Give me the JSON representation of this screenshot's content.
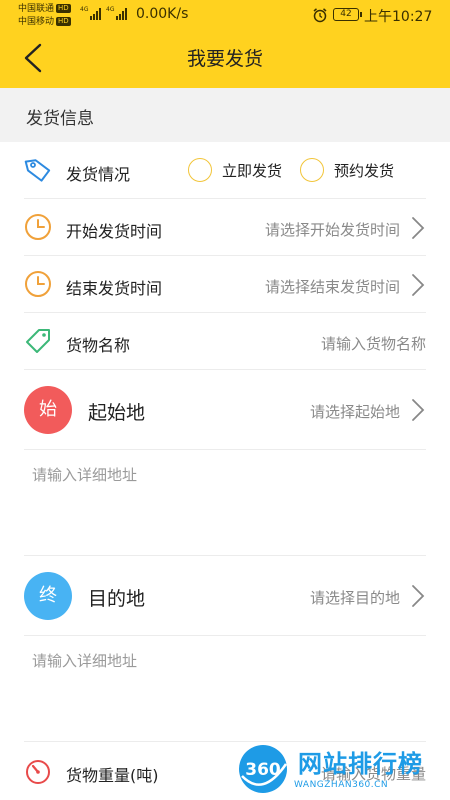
{
  "status_bar": {
    "carrier1": "中国联通",
    "carrier2": "中国移动",
    "hd_badge": "HD",
    "network": "4G",
    "speed": "0.00K/s",
    "battery": "42",
    "time": "上午10:27"
  },
  "header": {
    "title": "我要发货",
    "back_icon": "chevron-left-icon",
    "background": "#ffd21f"
  },
  "section": {
    "title": "发货信息"
  },
  "shipping_status": {
    "label": "发货情况",
    "icon": "tag-icon",
    "options": [
      "立即发货",
      "预约发货"
    ]
  },
  "start_time": {
    "label": "开始发货时间",
    "placeholder": "请选择开始发货时间",
    "icon": "clock-icon"
  },
  "end_time": {
    "label": "结束发货时间",
    "placeholder": "请选择结束发货时间",
    "icon": "clock-icon"
  },
  "goods_name": {
    "label": "货物名称",
    "placeholder": "请输入货物名称",
    "icon": "price-tag-icon"
  },
  "origin": {
    "badge": "始",
    "badge_color": "#f25b5b",
    "label": "起始地",
    "placeholder": "请选择起始地",
    "detail_placeholder": "请输入详细地址"
  },
  "destination": {
    "badge": "终",
    "badge_color": "#48b3f3",
    "label": "目的地",
    "placeholder": "请选择目的地",
    "detail_placeholder": "请输入详细地址"
  },
  "weight": {
    "label": "货物重量(吨)",
    "placeholder": "请输入货物重量",
    "icon": "gauge-icon"
  },
  "watermark": {
    "logo": "360",
    "title": "网站排行榜",
    "subtitle": "WANGZHAN360.CN"
  }
}
